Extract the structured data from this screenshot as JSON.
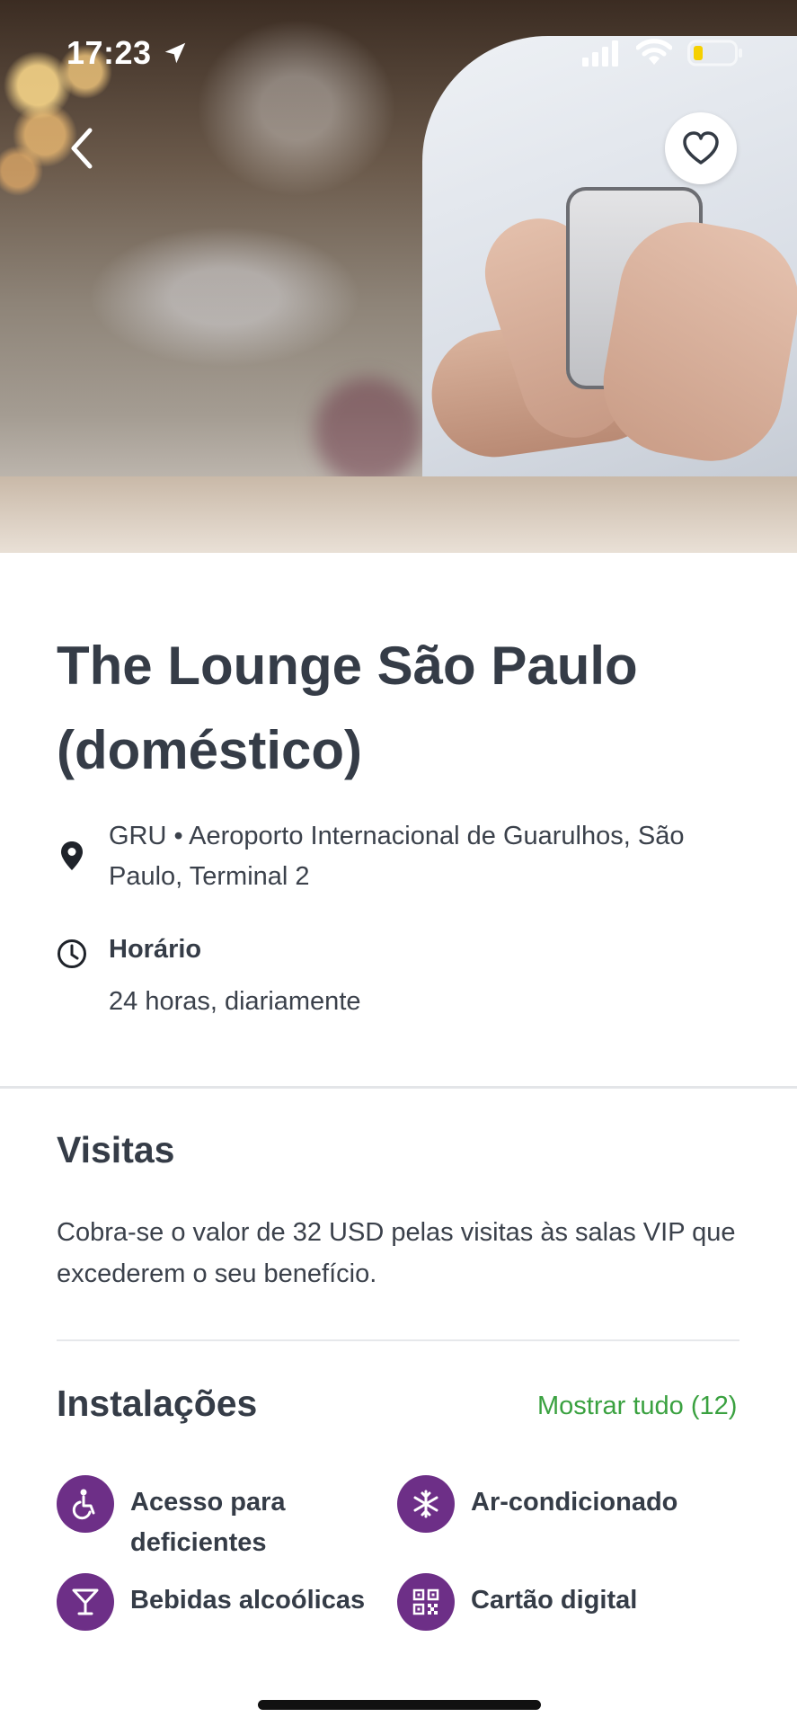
{
  "status_bar": {
    "time": "17:23"
  },
  "lounge": {
    "title": "The Lounge São Paulo (doméstico)",
    "location": "GRU • Aeroporto Internacional de Guarulhos, São Paulo, Terminal 2",
    "hours_label": "Horário",
    "hours_value": "24 horas, diariamente"
  },
  "visits": {
    "title": "Visitas",
    "text": "Cobra-se o valor de 32 USD pelas visitas às salas VIP que excederem o seu benefício."
  },
  "facilities": {
    "title": "Instalações",
    "show_all": "Mostrar tudo (12)",
    "items": [
      {
        "label": "Acesso para deficientes",
        "icon": "wheelchair-icon"
      },
      {
        "label": "Ar-condicionado",
        "icon": "snowflake-icon"
      },
      {
        "label": "Bebidas alcoólicas",
        "icon": "cocktail-icon"
      },
      {
        "label": "Cartão digital",
        "icon": "qr-code-icon"
      }
    ]
  },
  "colors": {
    "accent": "#6d2f87",
    "link": "#3aa140",
    "text": "#353c47"
  }
}
